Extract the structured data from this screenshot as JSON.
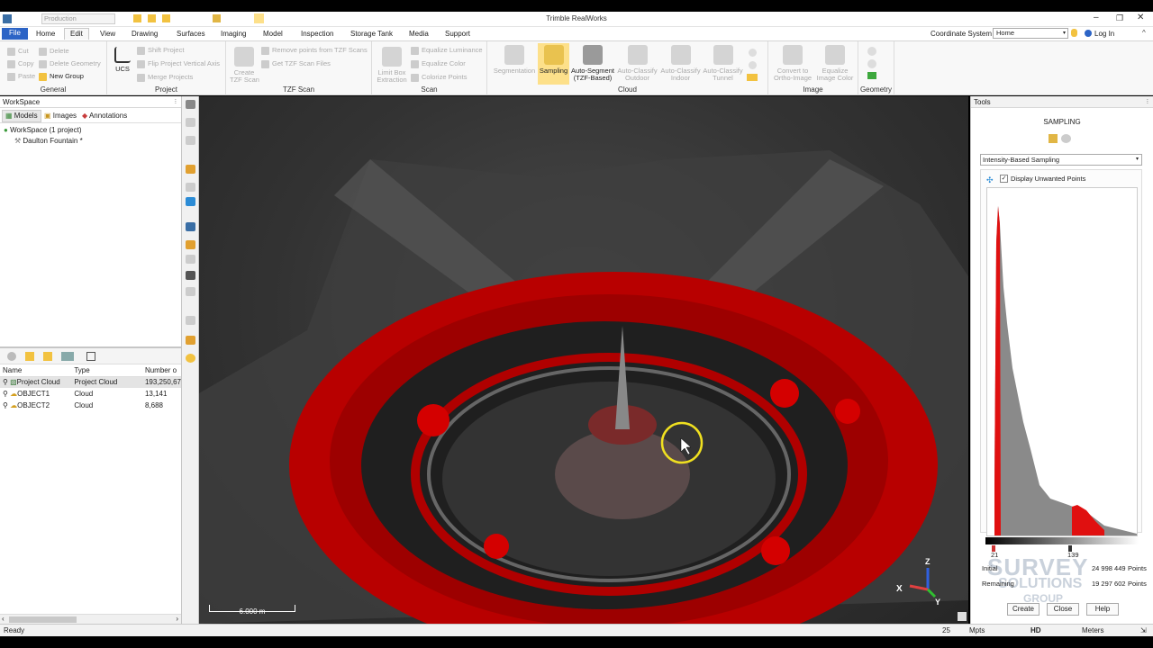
{
  "titlebar": {
    "title": "Trimble RealWorks",
    "project_field": "Production"
  },
  "menu_tabs": [
    {
      "label": "File"
    },
    {
      "label": "Home"
    },
    {
      "label": "Edit"
    },
    {
      "label": "View"
    },
    {
      "label": "Drawing"
    },
    {
      "label": "Surfaces"
    },
    {
      "label": "Imaging"
    },
    {
      "label": "Model"
    },
    {
      "label": "Inspection"
    },
    {
      "label": "Storage Tank"
    },
    {
      "label": "Media"
    },
    {
      "label": "Support"
    }
  ],
  "coord_system": {
    "label": "Coordinate System",
    "value": "Home",
    "login": "Log In"
  },
  "ribbon": {
    "general": {
      "label": "General",
      "cut": "Cut",
      "copy": "Copy",
      "paste": "Paste",
      "delete": "Delete",
      "delete_geometry": "Delete Geometry",
      "new_group": "New Group"
    },
    "project": {
      "label": "Project",
      "ucs": "UCS",
      "shift": "Shift Project",
      "flip": "Flip Project Vertical Axis",
      "merge": "Merge Projects"
    },
    "tzf": {
      "label": "TZF Scan",
      "create1": "Create",
      "create2": "TZF Scan",
      "remove": "Remove points from TZF Scans",
      "get": "Get TZF Scan Files"
    },
    "scan": {
      "label": "Scan",
      "limit1": "Limit Box",
      "limit2": "Extraction",
      "equalize_lum": "Equalize Luminance",
      "equalize_color": "Equalize Color",
      "colorize": "Colorize Points"
    },
    "cloud": {
      "label": "Cloud",
      "segmentation": "Segmentation",
      "sampling": "Sampling",
      "autoseg1": "Auto-Segment",
      "autoseg2": "(TZF-Based)",
      "outdoor1": "Auto-Classify",
      "outdoor2": "Outdoor",
      "indoor1": "Auto-Classify",
      "indoor2": "Indoor",
      "tunnel1": "Auto-Classify",
      "tunnel2": "Tunnel"
    },
    "image": {
      "label": "Image",
      "convert1": "Convert to",
      "convert2": "Ortho-Image",
      "equalize1": "Equalize",
      "equalize2": "Image Color"
    },
    "geometry": {
      "label": "Geometry"
    }
  },
  "workspace": {
    "title": "WorkSpace",
    "tabs": [
      "Models",
      "Images",
      "Annotations"
    ],
    "root": "WorkSpace  (1 project)",
    "project": "Daulton Fountain",
    "project_marker": "*"
  },
  "objects_table": {
    "headers": [
      "Name",
      "Type",
      "Number o"
    ],
    "rows": [
      {
        "name": "Project Cloud",
        "type": "Project Cloud",
        "count": "193,250,67"
      },
      {
        "name": "OBJECT1",
        "type": "Cloud",
        "count": "13,141"
      },
      {
        "name": "OBJECT2",
        "type": "Cloud",
        "count": "8,688"
      }
    ]
  },
  "viewport": {
    "scale_label": "6.000 m",
    "axis_x": "X",
    "axis_y": "Y",
    "axis_z": "Z"
  },
  "tools_panel": {
    "title": "Tools",
    "heading": "SAMPLING",
    "method": "Intensity-Based Sampling",
    "display_unwanted": "Display Unwanted Points",
    "display_unwanted_checked": true,
    "range_low": "21",
    "range_high": "139",
    "initial_label": "Initial",
    "initial_value": "24 998 449",
    "remaining_label": "Remaining",
    "remaining_value": "19 297 602",
    "points_unit": "Points",
    "buttons": {
      "create": "Create",
      "close": "Close",
      "help": "Help"
    }
  },
  "watermark": {
    "line1": "SURVEY",
    "line2": "SOLUTIONS",
    "line3": "GROUP"
  },
  "statusbar": {
    "ready": "Ready",
    "page": "25",
    "mpts": "Mpts",
    "hd": "HD",
    "units": "Meters"
  },
  "colors": {
    "accent": "#2c64c6",
    "selected": "#fde08a",
    "histogram_gray": "#8a8a8a",
    "histogram_red": "#e01010",
    "cloud_red": "#d40000"
  }
}
